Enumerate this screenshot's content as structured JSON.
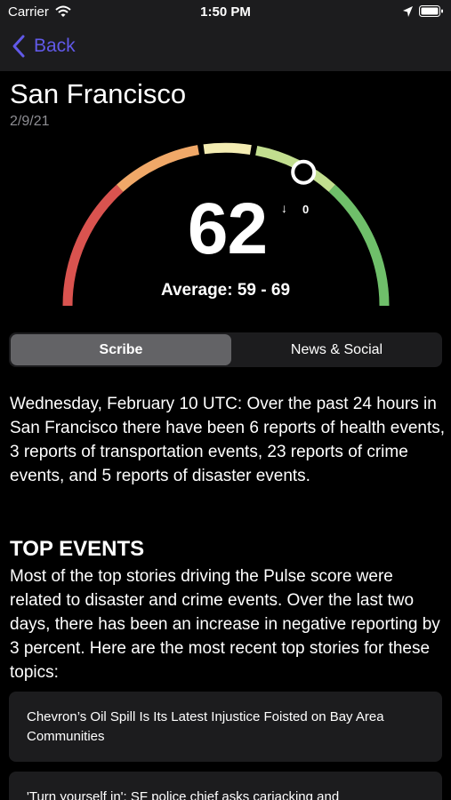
{
  "status_bar": {
    "carrier": "Carrier",
    "time": "1:50 PM"
  },
  "nav": {
    "back_label": "Back",
    "accent_color": "#6159e8"
  },
  "header": {
    "city": "San Francisco",
    "date": "2/9/21"
  },
  "gauge": {
    "score": "62",
    "trend_arrow": "↓",
    "trend_value": "0",
    "average_text": "Average: 59 - 69",
    "segment_colors": [
      "#d9534f",
      "#f0a868",
      "#f3ecb2",
      "#c2de8f",
      "#6fbf6a"
    ]
  },
  "tabs": {
    "scribe": "Scribe",
    "news_social": "News & Social",
    "selected": "Scribe"
  },
  "summary": "Wednesday, February 10 UTC: Over the past 24 hours in San Francisco there have been 6 reports of health events, 3 reports of transportation events, 23 reports of crime events, and  5 reports of disaster events.",
  "top_events": {
    "heading": "TOP EVENTS",
    "body": "Most of the top stories driving the Pulse score were related to disaster and crime events. Over the last two days, there has been an increase in negative reporting by 3 percent. Here are the most recent top stories for these topics:",
    "stories": [
      "Chevron’s Oil Spill Is Its Latest Injustice Foisted on Bay Area Communities",
      "'Turn yourself in': SF police chief asks carjacking and"
    ]
  }
}
